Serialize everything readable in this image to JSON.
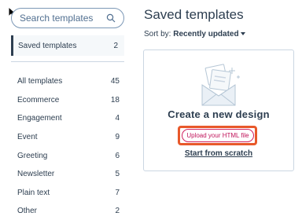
{
  "sidebar": {
    "search_placeholder": "Search templates",
    "saved": {
      "label": "Saved templates",
      "count": "2"
    },
    "categories": [
      {
        "label": "All templates",
        "count": "45"
      },
      {
        "label": "Ecommerce",
        "count": "18"
      },
      {
        "label": "Engagement",
        "count": "4"
      },
      {
        "label": "Event",
        "count": "9"
      },
      {
        "label": "Greeting",
        "count": "6"
      },
      {
        "label": "Newsletter",
        "count": "5"
      },
      {
        "label": "Plain text",
        "count": "7"
      },
      {
        "label": "Other",
        "count": "2"
      }
    ]
  },
  "main": {
    "title": "Saved templates",
    "sort_label": "Sort by:",
    "sort_value": "Recently updated",
    "card": {
      "title": "Create a new design",
      "upload_button": "Upload your HTML file",
      "scratch_link": "Start from scratch"
    }
  },
  "colors": {
    "accent": "#e8582a",
    "button_border": "#d0205e",
    "text": "#2d3e50"
  }
}
